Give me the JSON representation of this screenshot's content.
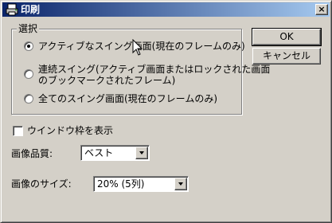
{
  "window": {
    "title": "印刷",
    "close_label": "×"
  },
  "group": {
    "legend": "選択",
    "options": [
      {
        "label": "アクティブなスイング画面(現在のフレームのみ)",
        "checked": true
      },
      {
        "label_line1": "連続スイング(アクティブ画面またはロックされた画面",
        "label_line2": "のブックマークされたフレーム)",
        "checked": false
      },
      {
        "label": "全てのスイング画面(現在のフレームのみ)",
        "checked": false
      }
    ]
  },
  "buttons": {
    "ok": "OK",
    "cancel": "キャンセル"
  },
  "frame_checkbox": {
    "label": "ウインドウ枠を表示",
    "checked": false
  },
  "quality": {
    "label": "画像品質:",
    "value": "ベスト"
  },
  "size": {
    "label": "画像のサイズ:",
    "value": "20% (5列)"
  }
}
